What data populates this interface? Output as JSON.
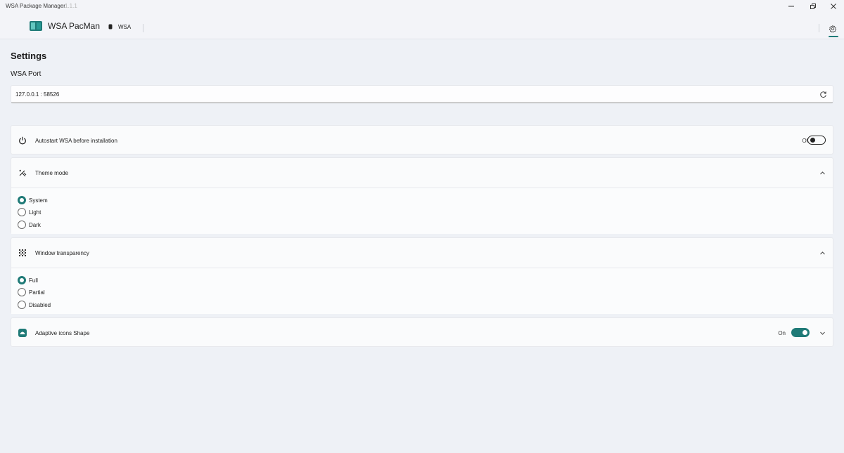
{
  "window": {
    "title": "WSA Package Manager",
    "version": "1.1.1",
    "accent": "#1f7a77"
  },
  "nav": {
    "brand": "WSA PacMan",
    "items": [
      {
        "label": "WSA",
        "icon": "android-icon"
      }
    ],
    "settings_icon": "gear-icon"
  },
  "settings": {
    "title": "Settings",
    "port": {
      "label": "WSA Port",
      "value": "127.0.0.1 :  58526",
      "reset_icon": "refresh-icon"
    },
    "autostart": {
      "label": "Autostart WSA before installation",
      "state_text": "Off",
      "enabled": false,
      "icon": "power-icon"
    },
    "theme": {
      "label": "Theme mode",
      "icon": "theme-icon",
      "expanded": true,
      "options": [
        "System",
        "Light",
        "Dark"
      ],
      "selected": "System"
    },
    "transparency": {
      "label": "Window transparency",
      "icon": "transparency-icon",
      "expanded": true,
      "options": [
        "Full",
        "Partial",
        "Disabled"
      ],
      "selected": "Full"
    },
    "adaptive": {
      "label": "Adaptive icons Shape",
      "state_text": "On",
      "enabled": true,
      "icon": "adaptive-icon"
    }
  }
}
